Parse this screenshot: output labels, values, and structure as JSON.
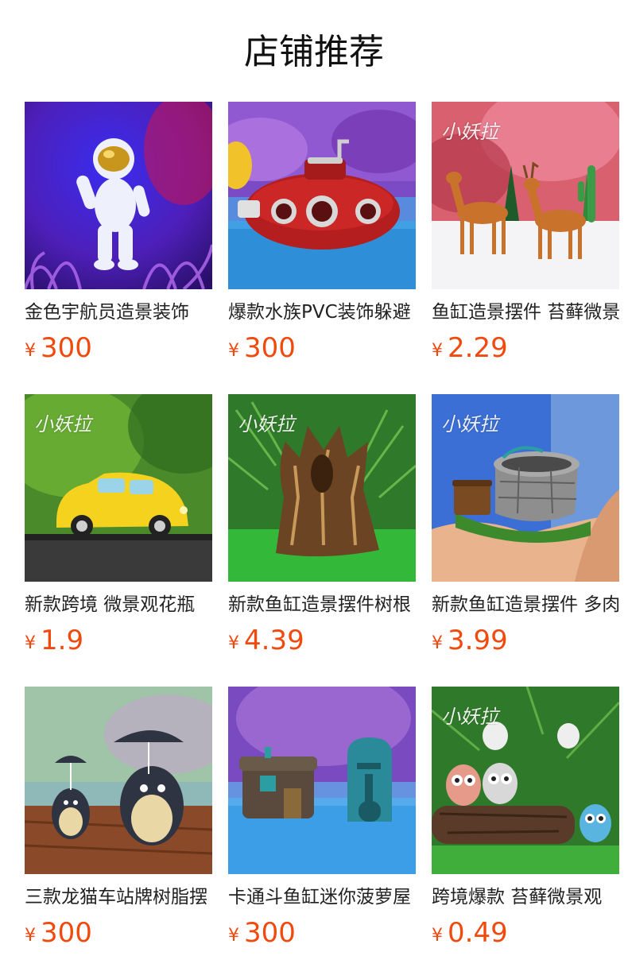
{
  "page": {
    "title": "店铺推荐"
  },
  "products": [
    {
      "name": "金色宇航员造景装饰",
      "currency": "¥",
      "price": "300",
      "image": "astronaut-figurine",
      "watermark": ""
    },
    {
      "name": "爆款水族PVC装饰躲避",
      "currency": "¥",
      "price": "300",
      "image": "red-submarine",
      "watermark": ""
    },
    {
      "name": "鱼缸造景摆件 苔藓微景",
      "currency": "¥",
      "price": "2.29",
      "image": "deer-figurines",
      "watermark": "小妖拉"
    },
    {
      "name": "新款跨境 微景观花瓶",
      "currency": "¥",
      "price": "1.9",
      "image": "yellow-car",
      "watermark": "小妖拉"
    },
    {
      "name": "新款鱼缸造景摆件树根",
      "currency": "¥",
      "price": "4.39",
      "image": "tree-stump",
      "watermark": "小妖拉"
    },
    {
      "name": "新款鱼缸造景摆件 多肉",
      "currency": "¥",
      "price": "3.99",
      "image": "stone-well",
      "watermark": "小妖拉"
    },
    {
      "name": "三款龙猫车站牌树脂摆",
      "currency": "¥",
      "price": "300",
      "image": "totoro-umbrella",
      "watermark": ""
    },
    {
      "name": "卡通斗鱼缸迷你菠萝屋",
      "currency": "¥",
      "price": "300",
      "image": "pineapple-house",
      "watermark": ""
    },
    {
      "name": "跨境爆款 苔藓微景观",
      "currency": "¥",
      "price": "0.49",
      "image": "owl-figurines",
      "watermark": "小妖拉"
    }
  ]
}
